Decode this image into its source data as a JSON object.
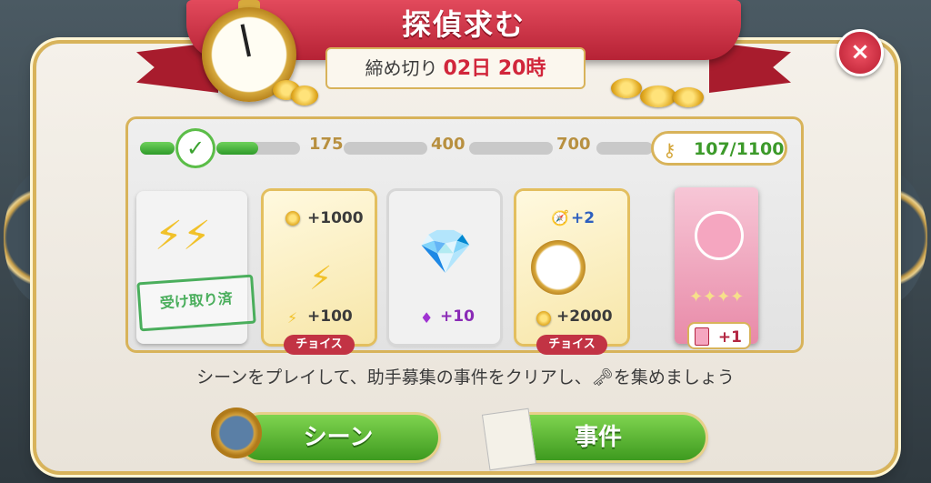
{
  "title": "探偵求む",
  "deadline": {
    "label": "締め切り",
    "value": "02日 20時"
  },
  "close_label": "×",
  "progress": {
    "milestones": [
      "175",
      "400",
      "700"
    ],
    "keys": "107/1100",
    "fill_fraction": 0.097,
    "check_symbol": "✓",
    "key_icon": "key-icon"
  },
  "cards": [
    {
      "stamp": "受け取り済"
    },
    {
      "top": "+1000",
      "bottom": "+100",
      "choice": "チョイス"
    },
    {
      "bottom": "+10"
    },
    {
      "top": "+2",
      "bottom": "+2000",
      "choice": "チョイス"
    }
  ],
  "book_badge": "+1",
  "description": "シーンをプレイして、助手募集の事件をクリアし、🗝を集めましょう",
  "buttons": {
    "scene": "シーン",
    "case": "事件"
  },
  "colors": {
    "ribbon": "#c8283c",
    "button_green": "#4caf2a",
    "accent_gold": "#d8b35a"
  }
}
